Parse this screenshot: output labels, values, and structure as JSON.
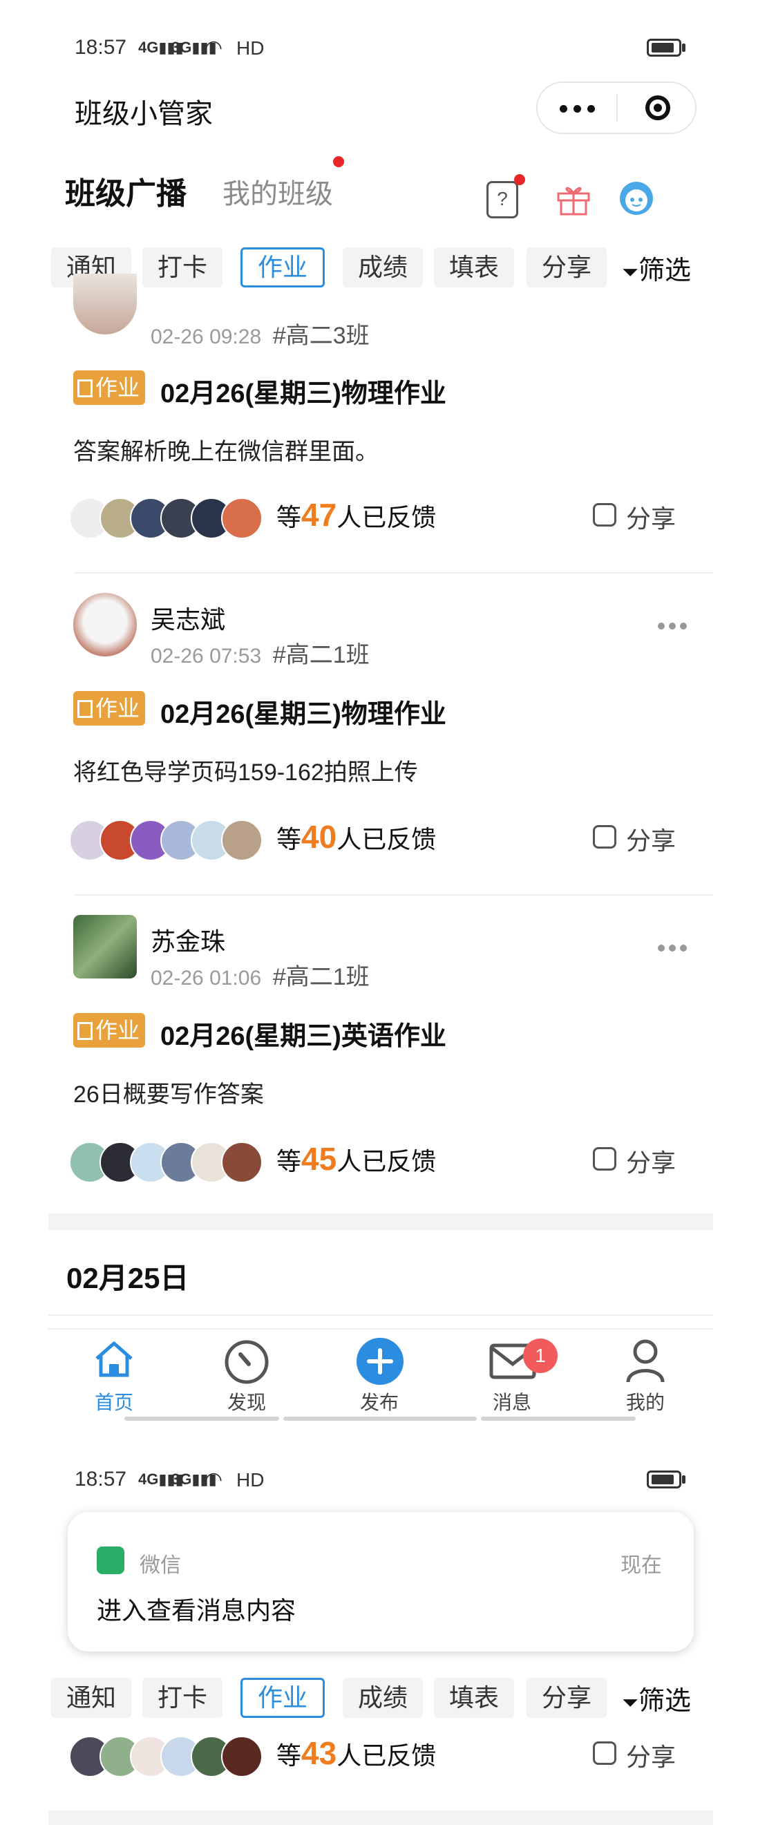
{
  "status_bar": {
    "time": "18:57",
    "signal1": "4G",
    "signal2": "3G",
    "hd": "HD"
  },
  "app": {
    "title": "班级小管家"
  },
  "tabs": {
    "main": "班级广播",
    "secondary": "我的班级"
  },
  "filters": {
    "items": [
      "通知",
      "打卡",
      "作业",
      "成绩",
      "填表",
      "分享"
    ],
    "active": "作业",
    "filter_label": "筛选"
  },
  "posts": [
    {
      "time": "02-26 09:28",
      "class": "#高二3班",
      "tag": "作业",
      "title": "02月26(星期三)物理作业",
      "body": "答案解析晚上在微信群里面。",
      "feedback_prefix": "等",
      "feedback_count": "47",
      "feedback_suffix": "人已反馈",
      "share_label": "分享"
    },
    {
      "author": "吴志斌",
      "time": "02-26 07:53",
      "class": "#高二1班",
      "tag": "作业",
      "title": "02月26(星期三)物理作业",
      "body": "将红色导学页码159-162拍照上传",
      "feedback_prefix": "等",
      "feedback_count": "40",
      "feedback_suffix": "人已反馈",
      "share_label": "分享"
    },
    {
      "author": "苏金珠",
      "time": "02-26 01:06",
      "class": "#高二1班",
      "tag": "作业",
      "title": "02月26(星期三)英语作业",
      "body": "26日概要写作答案",
      "feedback_prefix": "等",
      "feedback_count": "45",
      "feedback_suffix": "人已反馈",
      "share_label": "分享"
    }
  ],
  "date_header": "02月25日",
  "bottom_nav": [
    {
      "label": "首页",
      "icon": "home-icon",
      "active": true
    },
    {
      "label": "发现",
      "icon": "compass-icon"
    },
    {
      "label": "发布",
      "icon": "plus-icon"
    },
    {
      "label": "消息",
      "icon": "mail-icon",
      "badge": "1"
    },
    {
      "label": "我的",
      "icon": "person-icon"
    }
  ],
  "second_screen": {
    "status_time": "18:57",
    "notification": {
      "app": "微信",
      "time": "现在",
      "message": "进入查看消息内容"
    },
    "feedback_prefix": "等",
    "feedback_count": "43",
    "feedback_suffix": "人已反馈",
    "share_label": "分享"
  },
  "colors": {
    "accent": "#2b8ddf",
    "tag": "#e9a23b",
    "count": "#ef7d1f",
    "badge": "#f15b5b"
  }
}
